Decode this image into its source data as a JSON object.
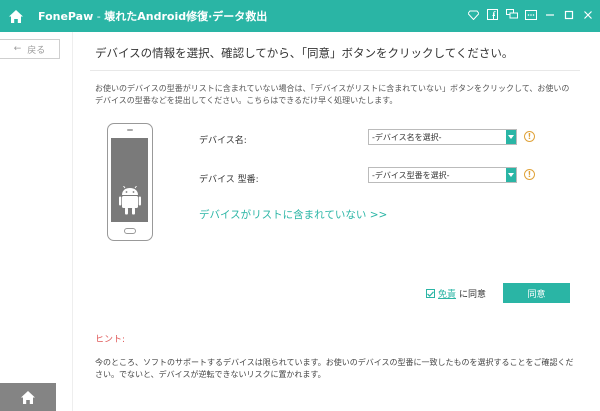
{
  "titlebar": {
    "brand": "FonePaw",
    "separator": " - ",
    "product": "壊れたAndroid修復·データ救出",
    "colors": {
      "accent": "#2ab5a5"
    },
    "icons": [
      "home-icon",
      "diamond-icon",
      "facebook-icon",
      "chat-icon",
      "menu-icon",
      "minimize-icon",
      "maximize-icon",
      "close-icon"
    ]
  },
  "sidebar": {
    "back_label": "戻る",
    "back_arrow": "←"
  },
  "main": {
    "heading": "デバイスの情報を選択、確認してから、「同意」ボタンをクリックしてください。",
    "description": "お使いのデバイスの型番がリストに含まれていない場合は、「デバイスがリストに含まれていない」ボタンをクリックして、お使いのデバイスの型番などを提出してください。こちらはできるだけ早く処理いたします。",
    "device_name_label": "デバイス名:",
    "device_name_select": "-デバイス名を選択-",
    "device_model_label": "デバイス 型番:",
    "device_model_select": "-デバイス型番を選択-",
    "help_glyph": "!",
    "not_listed_link": "デバイスがリストに含まれていない >>",
    "disclaimer_link": "免責",
    "agree_suffix": "に同意",
    "agree_button": "同意",
    "hint_label": "ヒント:",
    "hint_text": "今のところ、ソフトのサポートするデバイスは限られています。お使いのデバイスの型番に一致したものを選択することをご確認ください。でないと、デバイスが逆転できないリスクに置かれます。"
  }
}
